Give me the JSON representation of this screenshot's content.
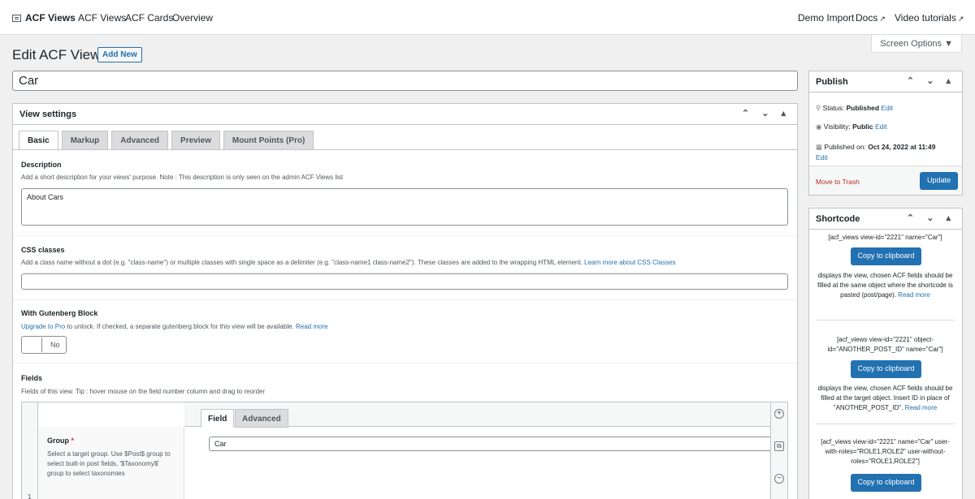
{
  "topbar": {
    "logo_label": "ACF Views",
    "nav": [
      "ACF Views",
      "ACF Cards",
      "Overview"
    ],
    "right_nav": {
      "demo_import": "Demo Import",
      "docs": "Docs",
      "video": "Video tutorials"
    },
    "external_glyph": "↗"
  },
  "screen_options": "Screen Options ▼",
  "page": {
    "title": "Edit ACF View",
    "add_new": "Add New",
    "post_title": "Car"
  },
  "view_settings": {
    "title": "View settings",
    "tabs": [
      "Basic",
      "Markup",
      "Advanced",
      "Preview",
      "Mount Points (Pro)"
    ],
    "description": {
      "label": "Description",
      "help": "Add a short description for your views' purpose. Note : This description is only seen on the admin ACF Views list",
      "value": "About Cars"
    },
    "css_classes": {
      "label": "CSS classes",
      "help": "Add a class name without a dot (e.g. \"class-name\") or multiple classes with single space as a delimiter (e.g. \"class-name1 class-name2\"). These classes are added to the wrapping HTML element.",
      "link": "Learn more about CSS Classes"
    },
    "gutenberg": {
      "label": "With Gutenberg Block",
      "link": "Upgrade to Pro",
      "help": "to unlock. If checked, a separate gutenberg block for this view will be available.",
      "read_more": "Read more",
      "toggle": "No"
    },
    "fields": {
      "label": "Fields",
      "help": "Fields of this view. Tip : hover mouse on the field number column and drag to reorder",
      "row_number": "1",
      "tabs": [
        "Field",
        "Advanced"
      ],
      "group_label": "Group",
      "required_mark": "*",
      "group_help": "Select a target group. Use $Post$ group to select built-in post fields, '$Taxonomy$' group to select taxonomies",
      "group_value": "Car"
    }
  },
  "publish": {
    "title": "Publish",
    "status_label": "Status:",
    "status_value": "Published",
    "visibility_label": "Visibility:",
    "visibility_value": "Public",
    "published_label": "Published on:",
    "published_value": "Oct 24, 2022 at 11:49",
    "edit": "Edit",
    "trash": "Move to Trash",
    "update": "Update"
  },
  "shortcode": {
    "title": "Shortcode",
    "copy": "Copy to clipboard",
    "read_more": "Read more",
    "items": [
      {
        "code": "[acf_views view-id=\"2221\" name=\"Car\"]",
        "desc": "displays the view, chosen ACF fields should be filled at the same object where the shortcode is pasted (post/page)."
      },
      {
        "code": "[acf_views view-id=\"2221\" object-id=\"ANOTHER_POST_ID\" name=\"Car\"]",
        "desc": "displays the view, chosen ACF fields should be filled at the target object. Insert ID in place of \"ANOTHER_POST_ID\"."
      },
      {
        "code": "[acf_views view-id=\"2221\" name=\"Car\" user-with-roles=\"ROLE1,ROLE2\" user-without-roles=\"ROLE1,ROLE2\"]"
      }
    ]
  },
  "icons": {
    "handles": "⌃ ⌄ ▴"
  }
}
